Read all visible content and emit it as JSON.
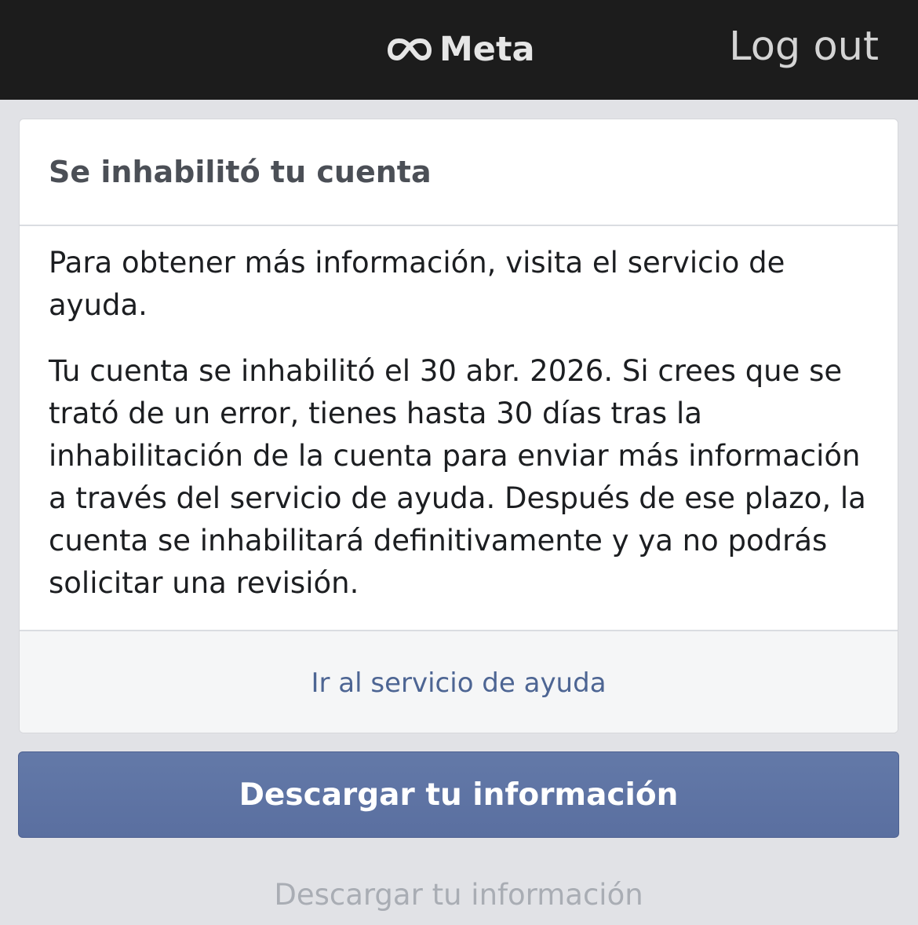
{
  "header": {
    "logo_text": "Meta",
    "logout_label": "Log out"
  },
  "card": {
    "title": "Se inhabilitó tu cuenta",
    "paragraphs": [
      "Para obtener más información, visita el servicio de ayuda.",
      "Tu cuenta se inhabilitó el 30 abr. 2026. Si crees que se trató de un error, tienes hasta 30 días tras la inhabilitación de la cuenta para enviar más información a través del servicio de ayuda. Después de ese plazo, la cuenta se inhabilitará definitivamente y ya no podrás solicitar una revisión."
    ],
    "help_link": "Ir al servicio de ayuda"
  },
  "actions": {
    "primary_label": "Descargar tu información",
    "secondary_label": "Descargar tu información"
  },
  "colors": {
    "topbar": "#1c1c1c",
    "page_background": "#e1e2e6",
    "primary_button": "#5f74a5",
    "link": "#4d6593"
  },
  "icons": {
    "logo": "meta-infinity-icon"
  }
}
